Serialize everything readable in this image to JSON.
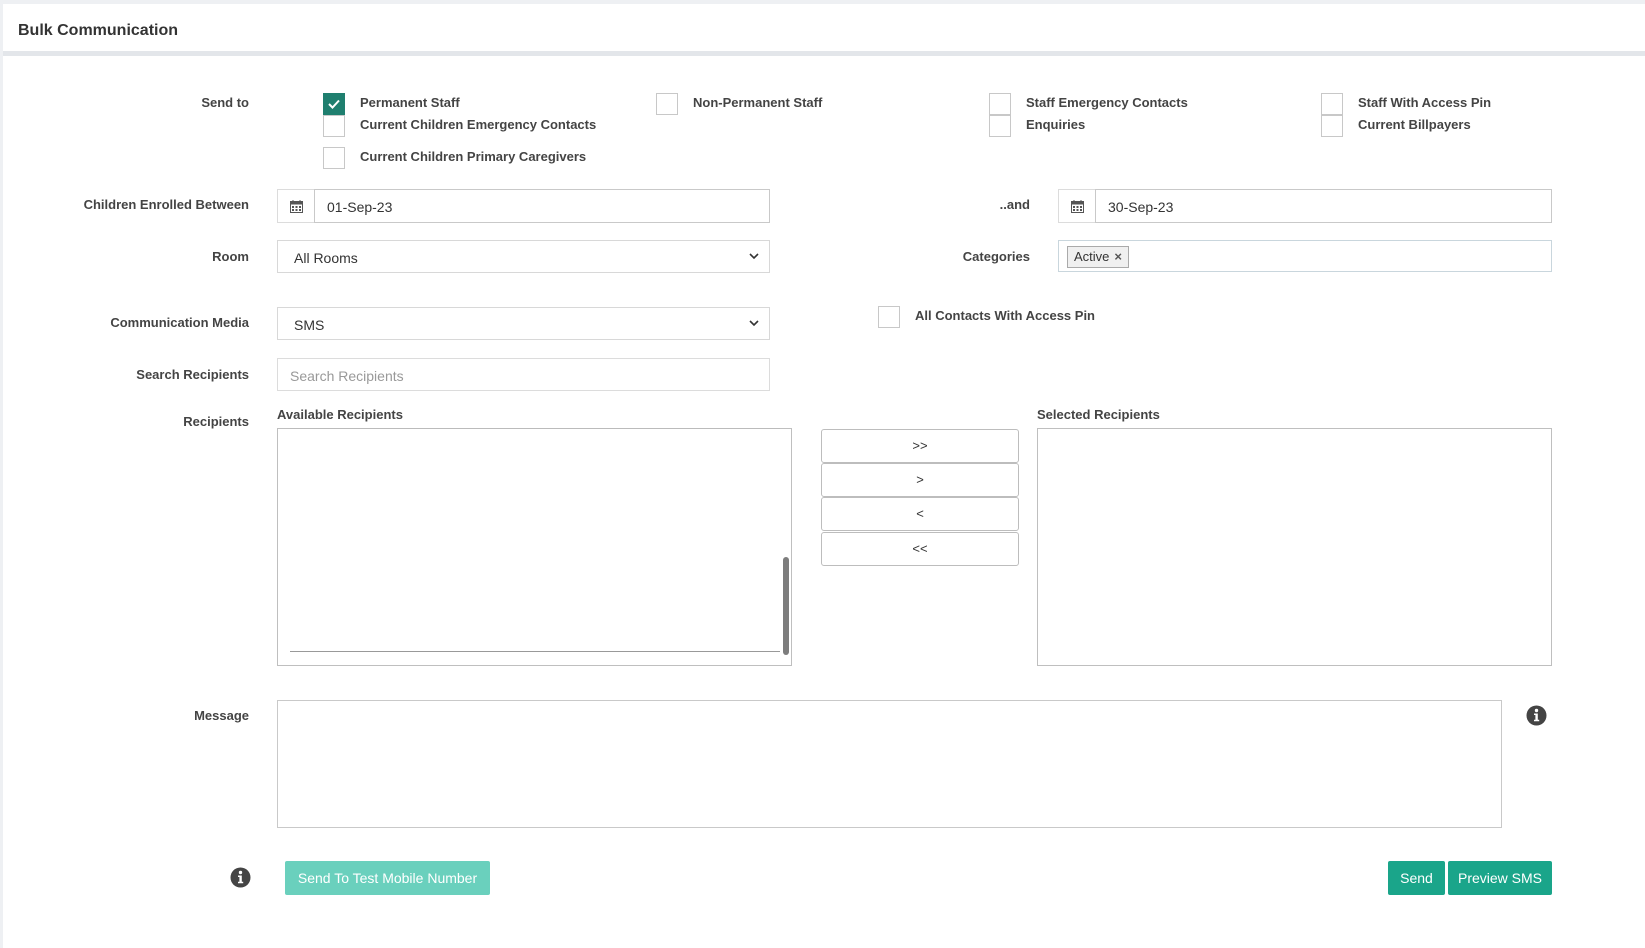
{
  "panel": {
    "title": "Bulk Communication"
  },
  "send_to": {
    "label": "Send to",
    "options": [
      {
        "label": "Permanent Staff",
        "checked": true
      },
      {
        "label": "Non-Permanent Staff",
        "checked": false
      },
      {
        "label": "Staff Emergency Contacts",
        "checked": false
      },
      {
        "label": "Staff With Access Pin",
        "checked": false
      },
      {
        "label": "Current Children Emergency Contacts",
        "checked": false
      },
      {
        "label": "Enquiries",
        "checked": false
      },
      {
        "label": "Current Billpayers",
        "checked": false
      },
      {
        "label": "Current Children Primary Caregivers",
        "checked": false
      }
    ]
  },
  "enrolled": {
    "label": "Children Enrolled Between",
    "from_value": "01-Sep-23",
    "and_label": "..and",
    "to_value": "30-Sep-23"
  },
  "room": {
    "label": "Room",
    "value": "All Rooms"
  },
  "categories": {
    "label": "Categories",
    "tags": [
      "Active"
    ]
  },
  "media": {
    "label": "Communication Media",
    "value": "SMS"
  },
  "access_pin": {
    "label": "All Contacts With Access Pin",
    "checked": false
  },
  "search": {
    "label": "Search Recipients",
    "placeholder": "Search Recipients"
  },
  "recipients": {
    "label": "Recipients",
    "available_label": "Available Recipients",
    "selected_label": "Selected Recipients",
    "move_buttons": [
      ">>",
      ">",
      "<",
      "<<"
    ]
  },
  "message": {
    "label": "Message"
  },
  "actions": {
    "test_label": "Send To Test Mobile Number",
    "send_label": "Send",
    "preview_label": "Preview SMS"
  },
  "colors": {
    "accent": "#1aa58a",
    "checked": "#1f7f6f",
    "disabled_button": "#6ad0bd"
  },
  "icons": [
    "calendar-icon",
    "chevron-down-icon",
    "info-icon",
    "check-icon",
    "close-icon"
  ]
}
